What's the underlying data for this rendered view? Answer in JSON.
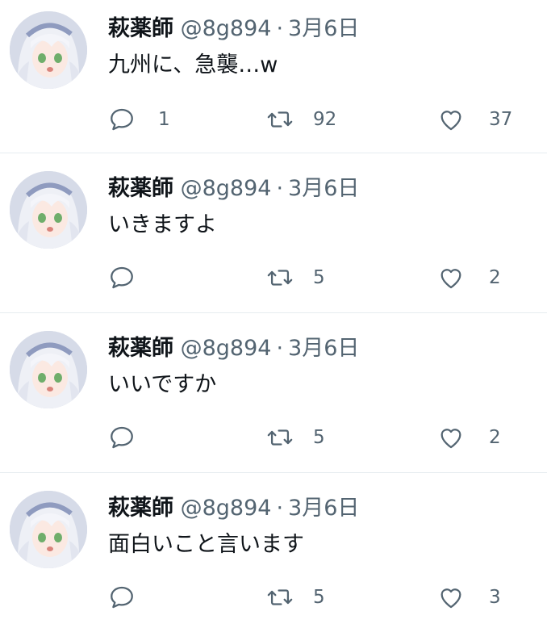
{
  "colors": {
    "text": "#0f1419",
    "secondary": "#536471",
    "divider": "#e6ecf0"
  },
  "icons": {
    "reply": "reply-icon",
    "retweet": "retweet-icon",
    "like": "heart-icon"
  },
  "tweets": [
    {
      "name": "萩薬師",
      "handle": "@8g894",
      "separator": "·",
      "date": "3月6日",
      "text": "九州に、急襲…w",
      "replies": "1",
      "retweets": "92",
      "likes": "37"
    },
    {
      "name": "萩薬師",
      "handle": "@8g894",
      "separator": "·",
      "date": "3月6日",
      "text": "いきますよ",
      "replies": "",
      "retweets": "5",
      "likes": "2"
    },
    {
      "name": "萩薬師",
      "handle": "@8g894",
      "separator": "·",
      "date": "3月6日",
      "text": "いいですか",
      "replies": "",
      "retweets": "5",
      "likes": "2"
    },
    {
      "name": "萩薬師",
      "handle": "@8g894",
      "separator": "·",
      "date": "3月6日",
      "text": "面白いこと言います",
      "replies": "",
      "retweets": "5",
      "likes": "3"
    }
  ]
}
